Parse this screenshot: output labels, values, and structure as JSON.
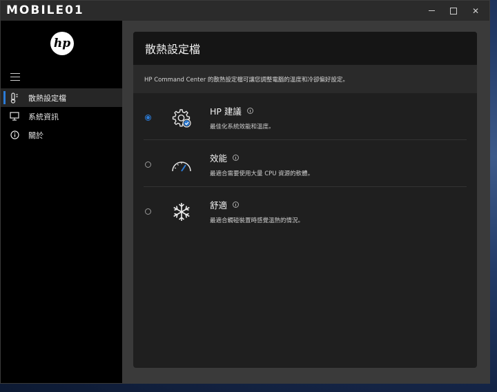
{
  "watermark": "MOBILE01",
  "window": {
    "minimize_icon": "minimize-icon",
    "maximize_icon": "maximize-icon",
    "close_label": "✕"
  },
  "sidebar": {
    "logo_text": "hp",
    "items": [
      {
        "label": "散熱設定檔",
        "icon": "thermometer-icon",
        "active": true
      },
      {
        "label": "系統資訊",
        "icon": "monitor-icon",
        "active": false
      },
      {
        "label": "關於",
        "icon": "info-icon",
        "active": false
      }
    ]
  },
  "main": {
    "title": "散熱設定檔",
    "description": "HP Command Center 的散熱設定檔可讓您調整電腦的溫度和冷卻偏好設定。",
    "options": [
      {
        "title": "HP 建議",
        "description": "最佳化系統效能和溫度。",
        "icon": "gear-check-icon",
        "selected": true
      },
      {
        "title": "效能",
        "description": "最適合需要使用大量 CPU 資源的軟體。",
        "icon": "speedometer-icon",
        "selected": false
      },
      {
        "title": "舒適",
        "description": "最適合觸碰裝置時感覺溫熱的情況。",
        "icon": "snowflake-icon",
        "selected": false
      }
    ]
  },
  "colors": {
    "accent": "#2b7bd6",
    "sidebar_bg": "#000000",
    "card_bg": "#1f1f1f"
  }
}
